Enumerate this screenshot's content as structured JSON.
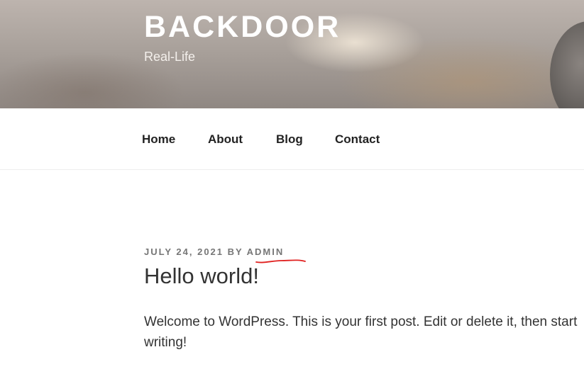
{
  "header": {
    "site_title": "BACKDOOR",
    "site_description": "Real-Life"
  },
  "nav": {
    "items": [
      {
        "label": "Home"
      },
      {
        "label": "About"
      },
      {
        "label": "Blog"
      },
      {
        "label": "Contact"
      }
    ]
  },
  "post": {
    "date": "JULY 24, 2021",
    "by": "BY",
    "author": "ADMIN",
    "title": "Hello world!",
    "body": "Welcome to WordPress. This is your first post. Edit or delete it, then start writing!"
  },
  "colors": {
    "annotation_underline": "#e0201f",
    "text": "#333333",
    "meta": "#767676"
  }
}
